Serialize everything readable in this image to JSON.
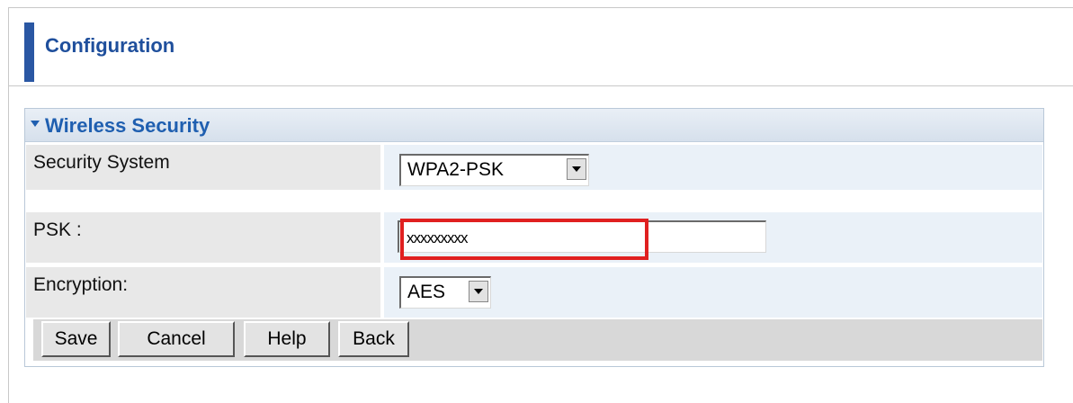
{
  "header": {
    "title": "Configuration"
  },
  "panel": {
    "title": "Wireless Security",
    "rows": [
      {
        "label": "Security System",
        "value": "WPA2-PSK"
      },
      {
        "label": "PSK :",
        "value": "xxxxxxxxx"
      },
      {
        "label": "Encryption:",
        "value": "AES"
      }
    ]
  },
  "buttons": {
    "save": "Save",
    "cancel": "Cancel",
    "help": "Help",
    "back": "Back"
  },
  "colors": {
    "accent": "#2a57a3",
    "title": "#1f5fb0",
    "highlight": "#e02020"
  }
}
